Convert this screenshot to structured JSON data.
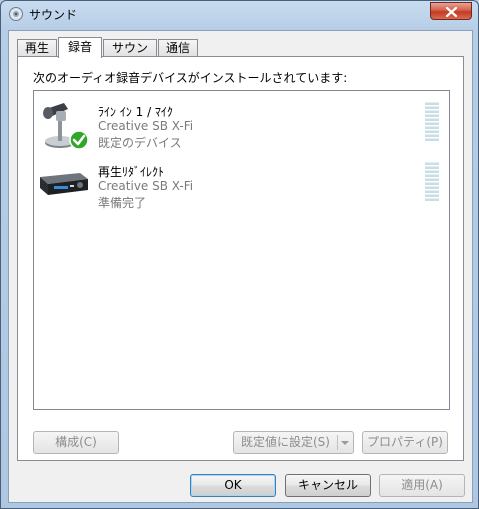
{
  "window": {
    "title": "サウンド",
    "close_icon": "close-icon"
  },
  "tabs": [
    {
      "label": "再生",
      "active": false
    },
    {
      "label": "録音",
      "active": true
    },
    {
      "label": "サウンド",
      "active": false
    },
    {
      "label": "通信",
      "active": false
    }
  ],
  "panel": {
    "instruction": "次のオーディオ録音デバイスがインストールされています:",
    "devices": [
      {
        "name": "ﾗｲﾝ ｲﾝ 1 / ﾏｲｸ",
        "driver": "Creative SB X-Fi",
        "status": "既定のデバイス",
        "icon": "microphone-icon",
        "default_badge": "check-icon"
      },
      {
        "name": "再生ﾘﾀﾞｲﾚｸﾄ",
        "driver": "Creative SB X-Fi",
        "status": "準備完了",
        "icon": "sound-card-icon"
      }
    ],
    "configure_label": "構成(C)",
    "set_default_label": "既定値に設定(S)",
    "properties_label": "プロパティ(P)"
  },
  "footer": {
    "ok_label": "OK",
    "cancel_label": "キャンセル",
    "apply_label": "適用(A)"
  },
  "colors": {
    "accent": "#3c7fb1",
    "check": "#2fa82a"
  }
}
